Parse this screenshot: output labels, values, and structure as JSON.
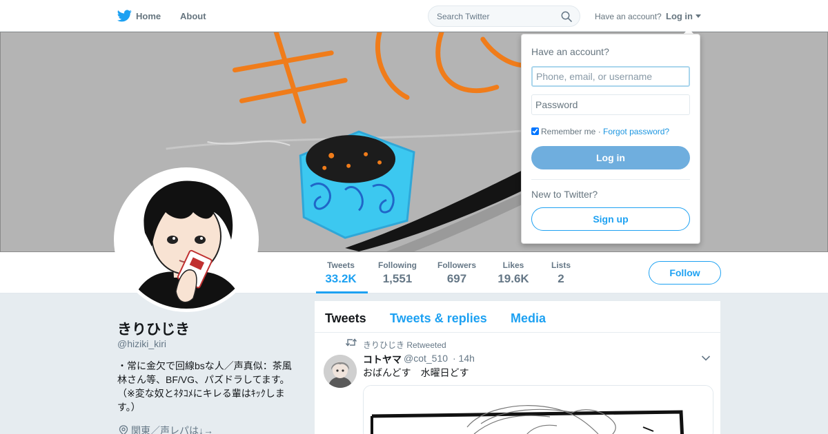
{
  "nav": {
    "home_label": "Home",
    "about_label": "About",
    "search_placeholder": "Search Twitter",
    "have_account": "Have an account?",
    "login_label": "Log in"
  },
  "profile": {
    "name": "きりひじき",
    "handle": "@hiziki_kiri",
    "bio": "・常に金欠で回線bsな人／声真似：茶風林さん等、BF/VG、パズドラしてます。（※変な奴とﾈﾀｺﾒにキレる輩はｷｯｸします。）",
    "location": "関東／声レパは↓→",
    "follow_label": "Follow"
  },
  "stats": [
    {
      "label": "Tweets",
      "value": "33.2K"
    },
    {
      "label": "Following",
      "value": "1,551"
    },
    {
      "label": "Followers",
      "value": "697"
    },
    {
      "label": "Likes",
      "value": "19.6K"
    },
    {
      "label": "Lists",
      "value": "2"
    }
  ],
  "timeline": {
    "tabs": [
      "Tweets",
      "Tweets & replies",
      "Media"
    ],
    "tweet": {
      "retweeted_by": "きりひじき Retweeted",
      "author_name": "コトヤマ",
      "author_handle": "@cot_510",
      "time": "· 14h",
      "text": "おばんどす　水曜日どす"
    }
  },
  "login": {
    "title": "Have an account?",
    "username_placeholder": "Phone, email, or username",
    "password_placeholder": "Password",
    "remember_label": "Remember me",
    "separator": "·",
    "forgot_label": "Forgot password?",
    "login_button": "Log in",
    "new_to_twitter": "New to Twitter?",
    "signup_button": "Sign up"
  },
  "colors": {
    "accent": "#1da1f2",
    "login_button": "#6faede",
    "banner_bg": "#b4b4b4",
    "banner_text": "#f07c1a"
  }
}
